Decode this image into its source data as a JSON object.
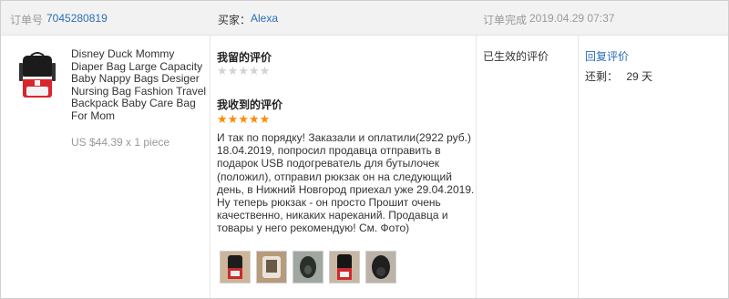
{
  "header": {
    "order_label": "订单号",
    "order_number": "7045280819",
    "buyer_label": "买家：",
    "buyer_name": "Alexa",
    "completed_label": "订单完成",
    "completed_time": "2019.04.29 07:37"
  },
  "product": {
    "title": "Disney Duck Mommy Diaper Bag Large Capacity Baby Nappy Bags Desiger Nursing Bag Fashion Travel Backpack Baby Care Bag For Mom",
    "price": "US $44.39 x 1 piece",
    "thumbnail_icon": "backpack-icon"
  },
  "my_review": {
    "title": "我留的评价",
    "rating": 0,
    "max_rating": 5
  },
  "received_review": {
    "title": "我收到的评价",
    "rating": 5,
    "max_rating": 5,
    "text": "И так по порядку! Заказали и оплатили(2922 руб.) 18.04.2019, попросил продавца отправить в подарок USB подогреватель для бутылочек (положил), отправил рюкзак он на следующий день, в Нижний Новгород приехал уже 29.04.2019. Ну теперь рюкзак - он просто Прошит очень качественно, никаких нареканий. Продавца и товары у него рекомендую! См. Фото)",
    "photos": [
      {
        "icon": "backpack-photo-1"
      },
      {
        "icon": "backpack-photo-2"
      },
      {
        "icon": "backpack-photo-3"
      },
      {
        "icon": "backpack-photo-4"
      },
      {
        "icon": "backpack-photo-5"
      }
    ]
  },
  "status": {
    "valid_label": "已生效的评价"
  },
  "actions": {
    "reply_label": "回复评价",
    "remaining_label": "还剩：",
    "remaining_value": "29 天"
  },
  "colors": {
    "link": "#2a6db8",
    "star_full": "#ff8a00",
    "star_empty": "#d3d3d3",
    "header_bg": "#f2f2f2"
  }
}
